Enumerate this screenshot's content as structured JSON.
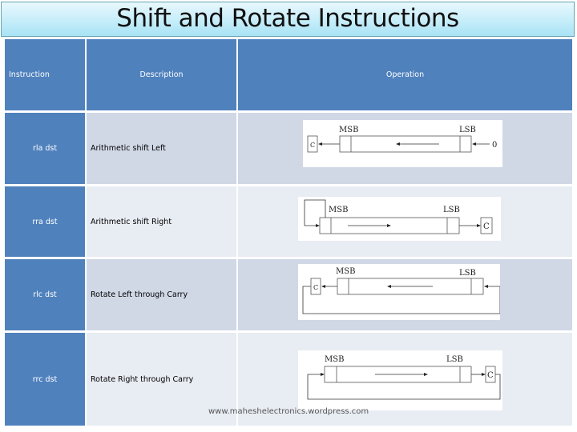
{
  "title": "Shift and Rotate Instructions",
  "table": {
    "headers": {
      "instruction": "Instruction",
      "description": "Description",
      "operation": "Operation"
    },
    "rows": [
      {
        "instruction": "rla  dst",
        "description": "Arithmetic shift Left",
        "diagram": {
          "msb": "MSB",
          "lsb": "LSB",
          "carry": "C",
          "input": "0"
        }
      },
      {
        "instruction": "rra  dst",
        "description": "Arithmetic shift Right",
        "diagram": {
          "msb": "MSB",
          "lsb": "LSB",
          "carry": "C"
        }
      },
      {
        "instruction": "rlc  dst",
        "description": "Rotate Left through Carry",
        "diagram": {
          "msb": "MSB",
          "lsb": "LSB",
          "carry": "C"
        }
      },
      {
        "instruction": "rrc dst",
        "description": "Rotate Right through Carry",
        "diagram": {
          "msb": "MSB",
          "lsb": "LSB",
          "carry": "C"
        }
      }
    ]
  },
  "footer": "www.maheshelectronics.wordpress.com",
  "colors": {
    "header_blue": "#4F81BD",
    "row_odd": "#D0D8E6",
    "row_even": "#E8ECF3"
  }
}
